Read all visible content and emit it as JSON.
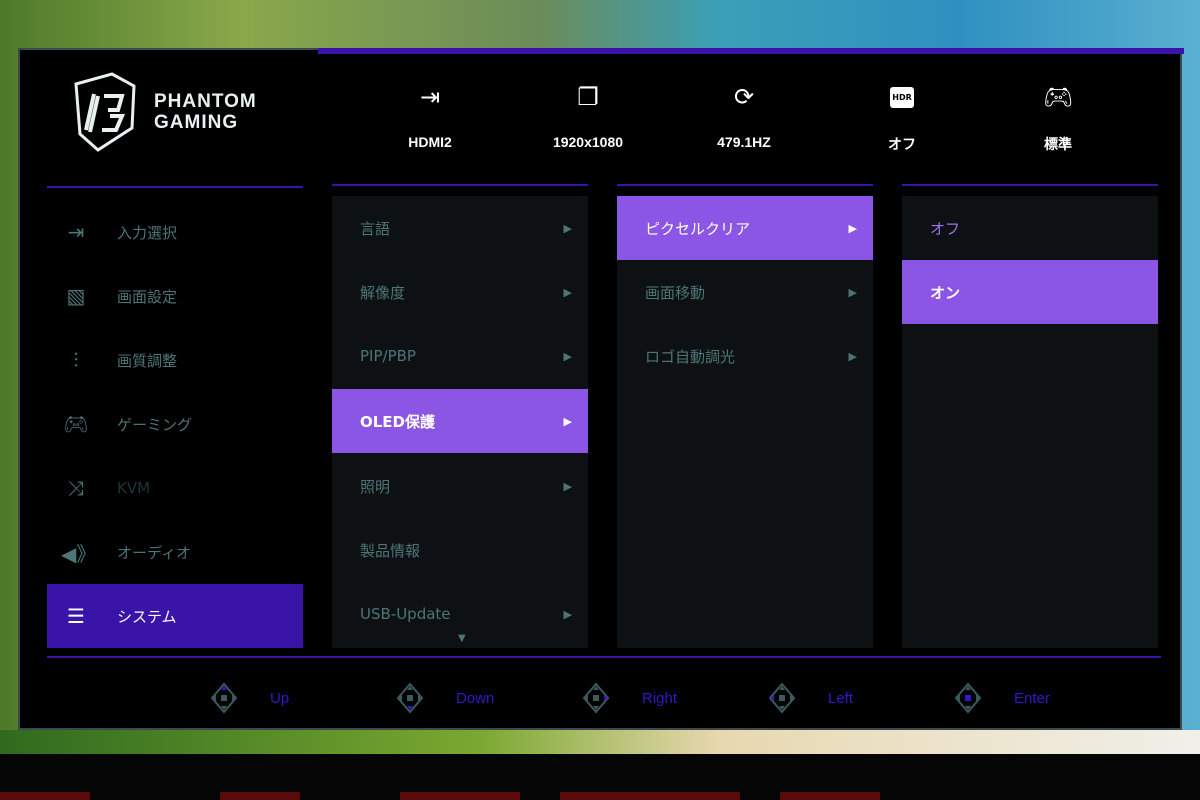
{
  "brand": {
    "line1": "PHANTOM",
    "line2": "GAMING"
  },
  "status": [
    {
      "icon": "input-icon",
      "value": "HDMI2"
    },
    {
      "icon": "resolution-icon",
      "value": "1920x1080"
    },
    {
      "icon": "refresh-icon",
      "value": "479.1HZ"
    },
    {
      "icon": "hdr-icon",
      "badge": "HDR",
      "value": "オフ"
    },
    {
      "icon": "gamepad-icon",
      "value": "標準"
    }
  ],
  "sidebar": [
    {
      "icon": "input-icon",
      "label": "入力選択"
    },
    {
      "icon": "image-icon",
      "label": "画面設定"
    },
    {
      "icon": "sliders-icon",
      "label": "画質調整"
    },
    {
      "icon": "gamepad-icon",
      "label": "ゲーミング"
    },
    {
      "icon": "shuffle-icon",
      "label": "KVM"
    },
    {
      "icon": "speaker-icon",
      "label": "オーディオ"
    },
    {
      "icon": "list-icon",
      "label": "システム",
      "selected": true
    }
  ],
  "menu1": [
    "言語",
    "解像度",
    "PIP/PBP",
    "OLED保護",
    "照明",
    "製品情報",
    "USB-Update"
  ],
  "menu2": [
    "ピクセルクリア",
    "画面移動",
    "ロゴ自動調光"
  ],
  "menu3": [
    "オフ",
    "オン"
  ],
  "arrow": "▶",
  "nav": [
    "Up",
    "Down",
    "Right",
    "Left",
    "Enter"
  ],
  "colors": {
    "accent": "#8b55e6",
    "selected": "#3a14a8",
    "text": "#4d7577",
    "nav": "#3a14c8"
  }
}
